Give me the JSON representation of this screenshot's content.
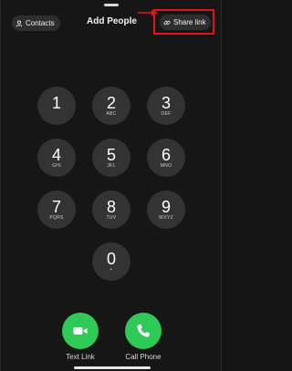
{
  "header": {
    "contacts_label": "Contacts",
    "title": "Add People",
    "share_label": "Share link",
    "contacts_icon": "person-icon",
    "share_icon": "link-icon",
    "highlight_color": "#e0161c"
  },
  "keypad": [
    {
      "digit": "1",
      "letters": ""
    },
    {
      "digit": "2",
      "letters": "ABC"
    },
    {
      "digit": "3",
      "letters": "DEF"
    },
    {
      "digit": "4",
      "letters": "GHI"
    },
    {
      "digit": "5",
      "letters": "JKL"
    },
    {
      "digit": "6",
      "letters": "MNO"
    },
    {
      "digit": "7",
      "letters": "PQRS"
    },
    {
      "digit": "8",
      "letters": "TUV"
    },
    {
      "digit": "9",
      "letters": "WXYZ"
    },
    {
      "digit": "0",
      "letters": "+"
    }
  ],
  "actions": {
    "text_link": {
      "label": "Text Link",
      "icon": "video-camera-icon"
    },
    "call_phone": {
      "label": "Call Phone",
      "icon": "phone-icon"
    },
    "accent_color": "#2ec957"
  }
}
